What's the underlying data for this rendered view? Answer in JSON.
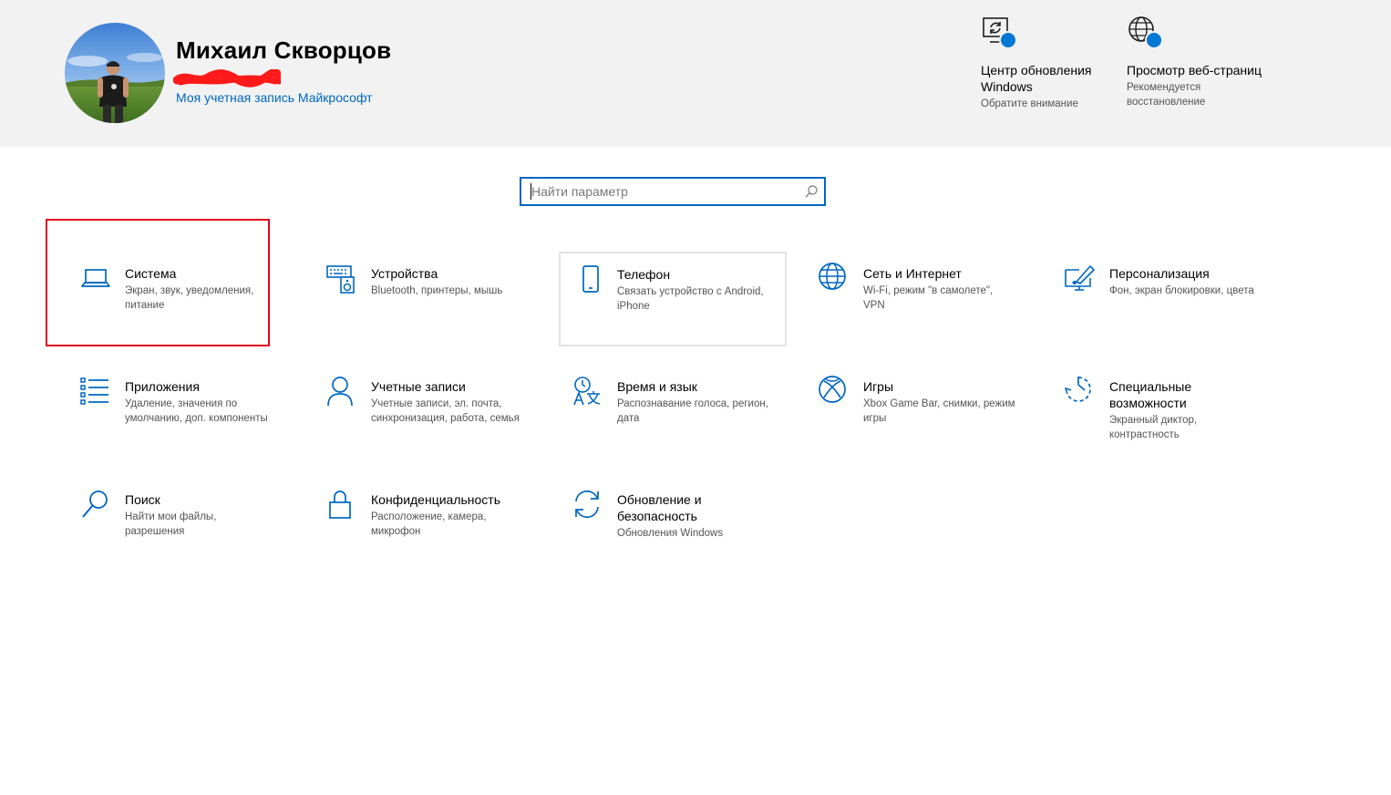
{
  "header": {
    "user_name": "Михаил Скворцов",
    "account_link": "Моя учетная запись Майкрософт",
    "notifications": [
      {
        "icon": "windows-update-icon",
        "title": "Центр обновления Windows",
        "subtitle": "Обратите внимание"
      },
      {
        "icon": "web-browsing-icon",
        "title": "Просмотр веб-страниц",
        "subtitle": "Рекомендуется восстановление"
      }
    ]
  },
  "search": {
    "placeholder": "Найти параметр",
    "value": ""
  },
  "tiles": [
    {
      "icon": "laptop-icon",
      "title": "Система",
      "desc": "Экран, звук, уведомления, питание"
    },
    {
      "icon": "devices-icon",
      "title": "Устройства",
      "desc": "Bluetooth, принтеры, мышь"
    },
    {
      "icon": "phone-icon",
      "title": "Телефон",
      "desc": "Связать устройство с Android, iPhone"
    },
    {
      "icon": "globe-icon",
      "title": "Сеть и Интернет",
      "desc": "Wi-Fi, режим \"в самолете\", VPN"
    },
    {
      "icon": "personalization-icon",
      "title": "Персонализация",
      "desc": "Фон, экран блокировки, цвета"
    },
    {
      "icon": "apps-list-icon",
      "title": "Приложения",
      "desc": "Удаление, значения по умолчанию, доп. компоненты"
    },
    {
      "icon": "person-icon",
      "title": "Учетные записи",
      "desc": "Учетные записи, эл. почта, синхронизация, работа, семья"
    },
    {
      "icon": "time-language-icon",
      "title": "Время и язык",
      "desc": "Распознавание голоса, регион, дата"
    },
    {
      "icon": "xbox-icon",
      "title": "Игры",
      "desc": "Xbox Game Bar, снимки, режим игры"
    },
    {
      "icon": "accessibility-icon",
      "title": "Специальные возможности",
      "desc": "Экранный диктор, контрастность"
    },
    {
      "icon": "search-magnifier-icon",
      "title": "Поиск",
      "desc": "Найти мои файлы, разрешения"
    },
    {
      "icon": "lock-icon",
      "title": "Конфиденциальность",
      "desc": "Расположение, камера, микрофон"
    },
    {
      "icon": "sync-icon",
      "title": "Обновление и безопасность",
      "desc": "Обновления Windows"
    }
  ],
  "colors": {
    "accent": "#0067c0",
    "header_bg": "#f2f2f2",
    "highlight_border": "#e0001b",
    "notification_dot": "#0078d4"
  }
}
